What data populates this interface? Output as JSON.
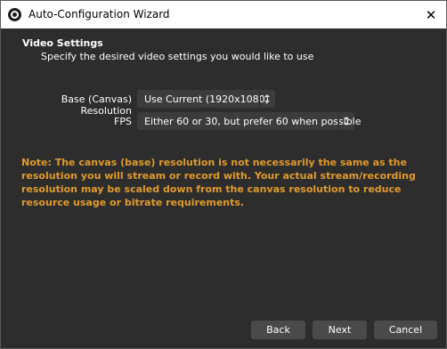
{
  "window": {
    "title": "Auto-Configuration Wizard",
    "close_glyph": "✕"
  },
  "page": {
    "heading": "Video Settings",
    "subheading": "Specify the desired video settings you would like to use"
  },
  "fields": {
    "resolution": {
      "label": "Base (Canvas) Resolution",
      "value": "Use Current (1920x1080)"
    },
    "fps": {
      "label": "FPS",
      "value": "Either 60 or 30, but prefer 60 when possible"
    }
  },
  "note": {
    "text": "Note: The canvas (base) resolution is not necessarily the same as the resolution you will stream or record with. Your actual stream/recording resolution may be scaled down from the canvas resolution to reduce resource usage or bitrate requirements.",
    "color": "#e09a2c"
  },
  "buttons": {
    "back": "Back",
    "next": "Next",
    "cancel": "Cancel"
  },
  "icons": {
    "app": "obs-logo-icon",
    "close": "close-icon"
  }
}
